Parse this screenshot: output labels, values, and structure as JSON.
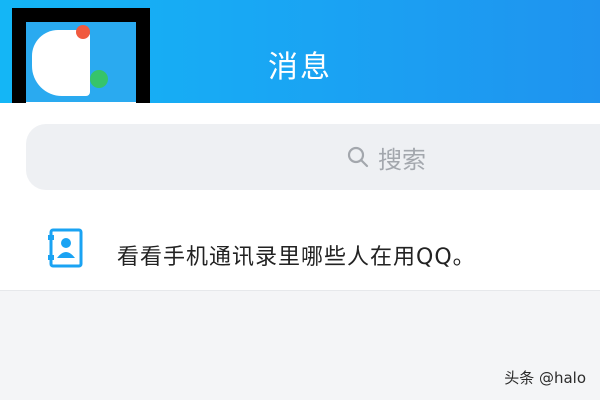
{
  "header": {
    "title": "消息",
    "avatar_icon": "avatar-icon",
    "status_online_color": "#36c46a",
    "notification_dot_color": "#f15a3f",
    "accent": "#1aa3f3"
  },
  "search": {
    "label": "搜索",
    "icon": "search-icon"
  },
  "contacts_hint": {
    "text": "看看手机通讯录里哪些人在用QQ。",
    "icon": "contacts-book-icon"
  },
  "watermark": {
    "text": "头条 @halo"
  }
}
